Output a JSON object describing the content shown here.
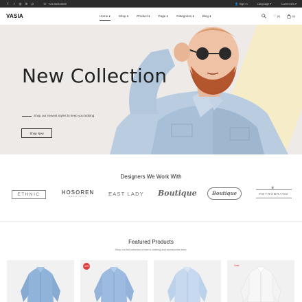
{
  "topbar": {
    "social": [
      "f",
      "t",
      "ig",
      "in",
      "p"
    ],
    "phone_icon": "phone-icon",
    "phone": "+00 0865 6589",
    "signin": "Sign in",
    "language": "Language",
    "currencies": "Currencies"
  },
  "header": {
    "logo": "VASIA",
    "nav": [
      "Home",
      "Shop",
      "Product",
      "Page",
      "Categories",
      "Blog"
    ],
    "wishlist_count": "(0)",
    "cart_count": "(0)"
  },
  "hero": {
    "title": "New Collection",
    "subtitle": "Shop our newest styles to keep you looking",
    "button": "Shop Now"
  },
  "designers": {
    "title": "Designers We Work With",
    "brands": [
      "ETHNIC",
      "HOSOREN",
      "EAST LADY",
      "Boutique",
      "Boutique",
      "RETROBRAND"
    ],
    "brand_taglines": [
      "",
      "ARCHITECTS",
      "",
      "",
      "",
      ""
    ]
  },
  "featured": {
    "title": "Featured Products",
    "subtitle": "Shop our full selection of men's clothing and accessories here.",
    "products": [
      {
        "badge": ""
      },
      {
        "badge": "-20%"
      },
      {
        "badge": ""
      },
      {
        "badge": "Sale"
      }
    ]
  },
  "colors": {
    "topbar": "#2b2b2b",
    "hero_bg": "#eeeae8",
    "accent": "#e23d3d"
  }
}
